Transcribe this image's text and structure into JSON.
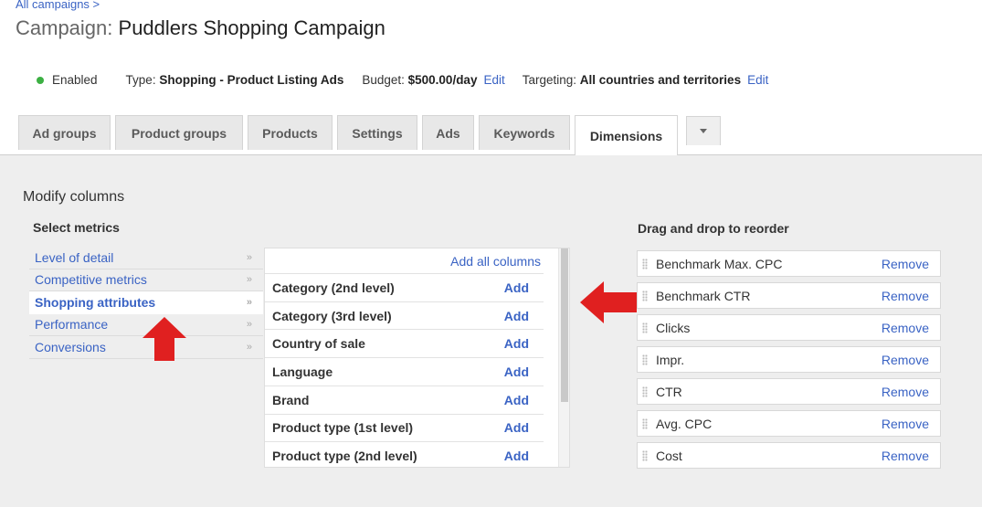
{
  "breadcrumb": "All campaigns >",
  "campaign": {
    "label": "Campaign:",
    "name": "Puddlers Shopping Campaign"
  },
  "status": {
    "state": "Enabled",
    "type_label": "Type:",
    "type_value": "Shopping - Product Listing Ads",
    "budget_label": "Budget:",
    "budget_value": "$500.00/day",
    "budget_edit": "Edit",
    "targeting_label": "Targeting:",
    "targeting_value": "All countries and territories",
    "targeting_edit": "Edit"
  },
  "tabs": [
    "Ad groups",
    "Product groups",
    "Products",
    "Settings",
    "Ads",
    "Keywords",
    "Dimensions"
  ],
  "active_tab": "Dimensions",
  "modify": {
    "title": "Modify columns",
    "select_metrics_title": "Select metrics",
    "categories": [
      "Level of detail",
      "Competitive metrics",
      "Shopping attributes",
      "Performance",
      "Conversions"
    ],
    "selected_category": "Shopping attributes",
    "add_all_label": "Add all columns",
    "columns": [
      {
        "name": "Category (2nd level)",
        "action": "Add"
      },
      {
        "name": "Category (3rd level)",
        "action": "Add"
      },
      {
        "name": "Country of sale",
        "action": "Add"
      },
      {
        "name": "Language",
        "action": "Add"
      },
      {
        "name": "Brand",
        "action": "Add"
      },
      {
        "name": "Product type (1st level)",
        "action": "Add"
      },
      {
        "name": "Product type (2nd level)",
        "action": "Add"
      }
    ],
    "reorder_title": "Drag and drop to reorder",
    "selected_columns": [
      {
        "name": "Benchmark Max. CPC",
        "action": "Remove"
      },
      {
        "name": "Benchmark CTR",
        "action": "Remove"
      },
      {
        "name": "Clicks",
        "action": "Remove"
      },
      {
        "name": "Impr.",
        "action": "Remove"
      },
      {
        "name": "CTR",
        "action": "Remove"
      },
      {
        "name": "Avg. CPC",
        "action": "Remove"
      },
      {
        "name": "Cost",
        "action": "Remove"
      }
    ]
  },
  "colors": {
    "link": "#3a63c4",
    "status_enabled": "#3cb043",
    "annotation_arrow": "#e02020"
  },
  "icons": {
    "category_chevron": "double-chevron-right-icon",
    "tab_more": "caret-down-icon",
    "drag_handle": "grip-icon"
  }
}
